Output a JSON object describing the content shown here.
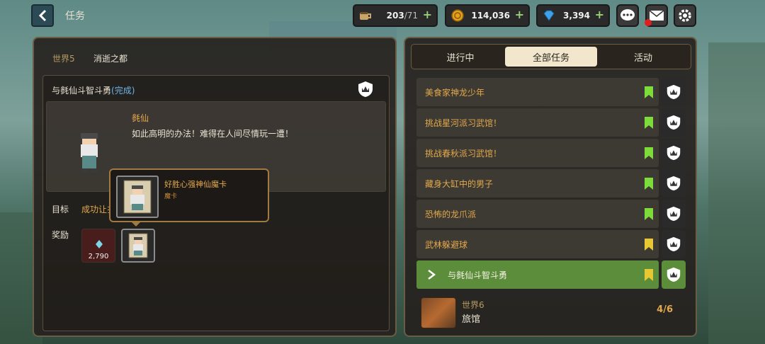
{
  "top_bar": {
    "title": "任务",
    "stamina_value": "203",
    "stamina_max": "/71",
    "gold_value": "114,036",
    "gem_value": "3,394"
  },
  "left": {
    "world_label": "世界5",
    "world_name": "消逝之都",
    "quest_title": "与毵仙斗智斗勇",
    "quest_status": "(完成)",
    "npc_name": "毵仙",
    "npc_line": "如此高明的办法！难得在人间尽情玩一遭！",
    "target_label": "目标",
    "target_text": "成功让扌",
    "reward_label": "奖励",
    "reward_gem_amount": "2,790"
  },
  "tooltip": {
    "title": "好胜心强神仙魔卡",
    "subtitle": "魔卡"
  },
  "tabs": [
    {
      "label": "进行中",
      "active": false
    },
    {
      "label": "全部任务",
      "active": true
    },
    {
      "label": "活动",
      "active": false
    }
  ],
  "quests": [
    {
      "label": "美食家神龙少年",
      "bookmark_color": "#7ddc3a",
      "selected": false
    },
    {
      "label": "挑战星河派习武馆！",
      "bookmark_color": "#7ddc3a",
      "selected": false
    },
    {
      "label": "挑战春秋派习武馆！",
      "bookmark_color": "#7ddc3a",
      "selected": false
    },
    {
      "label": "藏身大缸中的男子",
      "bookmark_color": "#7ddc3a",
      "selected": false
    },
    {
      "label": "恐怖的龙爪派",
      "bookmark_color": "#7ddc3a",
      "selected": false
    },
    {
      "label": "武林躲避球",
      "bookmark_color": "#e8c832",
      "selected": false
    },
    {
      "label": "与毵仙斗智斗勇",
      "bookmark_color": "#e8c832",
      "selected": true
    }
  ],
  "next_world": {
    "world_label": "世界6",
    "name": "旅馆",
    "progress": "4/6"
  },
  "colors": {
    "accent_orange": "#e3a84b",
    "selected_green": "#5c8d3a",
    "notification_red": "#e02020"
  }
}
